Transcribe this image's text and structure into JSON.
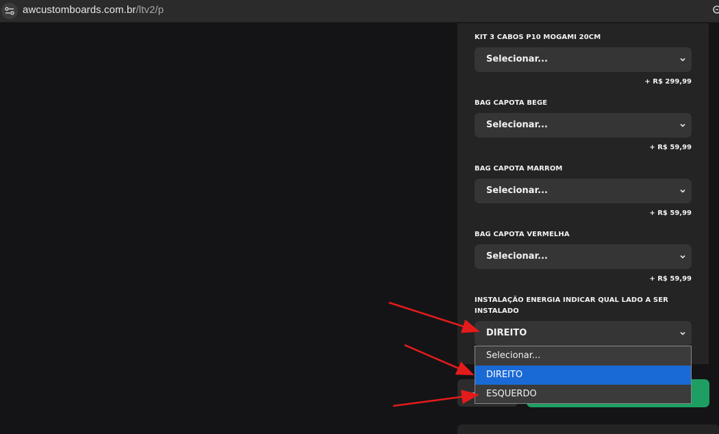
{
  "browser": {
    "url_host": "awcustomboards.com.br",
    "url_path": "/ltv2/p"
  },
  "options": [
    {
      "label": "KIT 3 CABOS P10 MOGAMI 20CM",
      "selected": "Selecionar...",
      "price": "+ R$ 299,99"
    },
    {
      "label": "BAG CAPOTA BEGE",
      "selected": "Selecionar...",
      "price": "+ R$ 59,99"
    },
    {
      "label": "BAG CAPOTA MARROM",
      "selected": "Selecionar...",
      "price": "+ R$ 59,99"
    },
    {
      "label": "BAG CAPOTA VERMELHA",
      "selected": "Selecionar...",
      "price": "+ R$ 59,99"
    }
  ],
  "installation": {
    "label_line1": "INSTALAÇÃO ENERGIA INDICAR QUAL LADO A SER",
    "label_line2": "INSTALADO",
    "selected": "DIREITO",
    "dropdown_options": [
      "Selecionar...",
      "DIREITO",
      "ESQUERDO"
    ],
    "highlighted_index": 1
  },
  "quantity": {
    "minus_label": "—"
  },
  "colors": {
    "background": "#141416",
    "panel": "#242424",
    "select": "#353535",
    "dropdown_highlight": "#1a6ad6",
    "buy_button": "#1e9e63",
    "annotation_arrow": "#e41b1b"
  }
}
